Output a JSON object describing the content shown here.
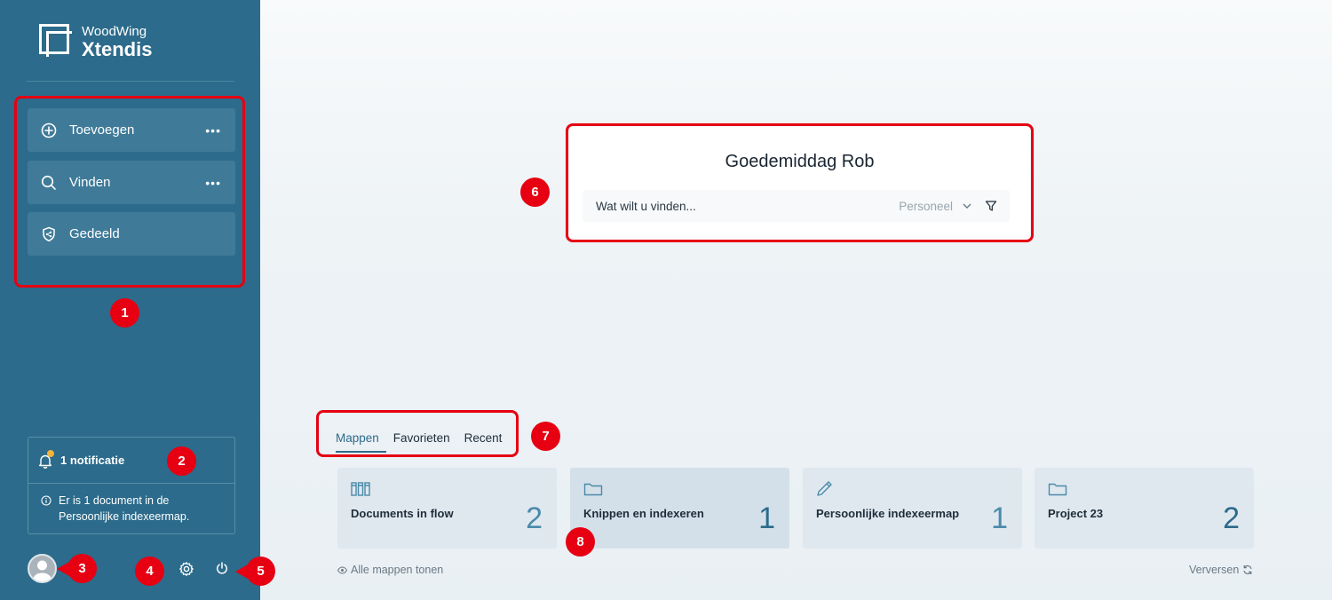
{
  "brand": {
    "line1": "WoodWing",
    "line2": "Xtendis"
  },
  "sidebar": {
    "items": [
      {
        "label": "Toevoegen",
        "icon": "plus-circle-icon",
        "more": "•••"
      },
      {
        "label": "Vinden",
        "icon": "search-icon",
        "more": "•••"
      },
      {
        "label": "Gedeeld",
        "icon": "shared-shield-icon"
      }
    ]
  },
  "notifications": {
    "title": "1 notificatie",
    "message": "Er is 1 document in de Persoonlijke indexeermap.",
    "badge_color": "#f3b33d"
  },
  "welcome": {
    "greeting": "Goedemiddag Rob",
    "search_placeholder": "Wat wilt u vinden...",
    "scope": "Personeel"
  },
  "tabs": [
    {
      "label": "Mappen",
      "active": true
    },
    {
      "label": "Favorieten",
      "active": false
    },
    {
      "label": "Recent",
      "active": false
    }
  ],
  "folders": [
    {
      "name": "Documents in flow",
      "count": "2",
      "icon": "binders-icon"
    },
    {
      "name": "Knippen en indexeren",
      "count": "1",
      "icon": "folder-icon"
    },
    {
      "name": "Persoonlijke indexeermap",
      "count": "1",
      "icon": "pencil-icon"
    },
    {
      "name": "Project 23",
      "count": "2",
      "icon": "folder-icon"
    }
  ],
  "footer": {
    "show_all": "Alle mappen tonen",
    "refresh": "Verversen"
  },
  "annotations": [
    "1",
    "2",
    "3",
    "4",
    "5",
    "6",
    "7",
    "8"
  ],
  "colors": {
    "sidebar": "#2c6b8b",
    "nav_item": "#3f7b99",
    "highlight": "#e60012"
  }
}
